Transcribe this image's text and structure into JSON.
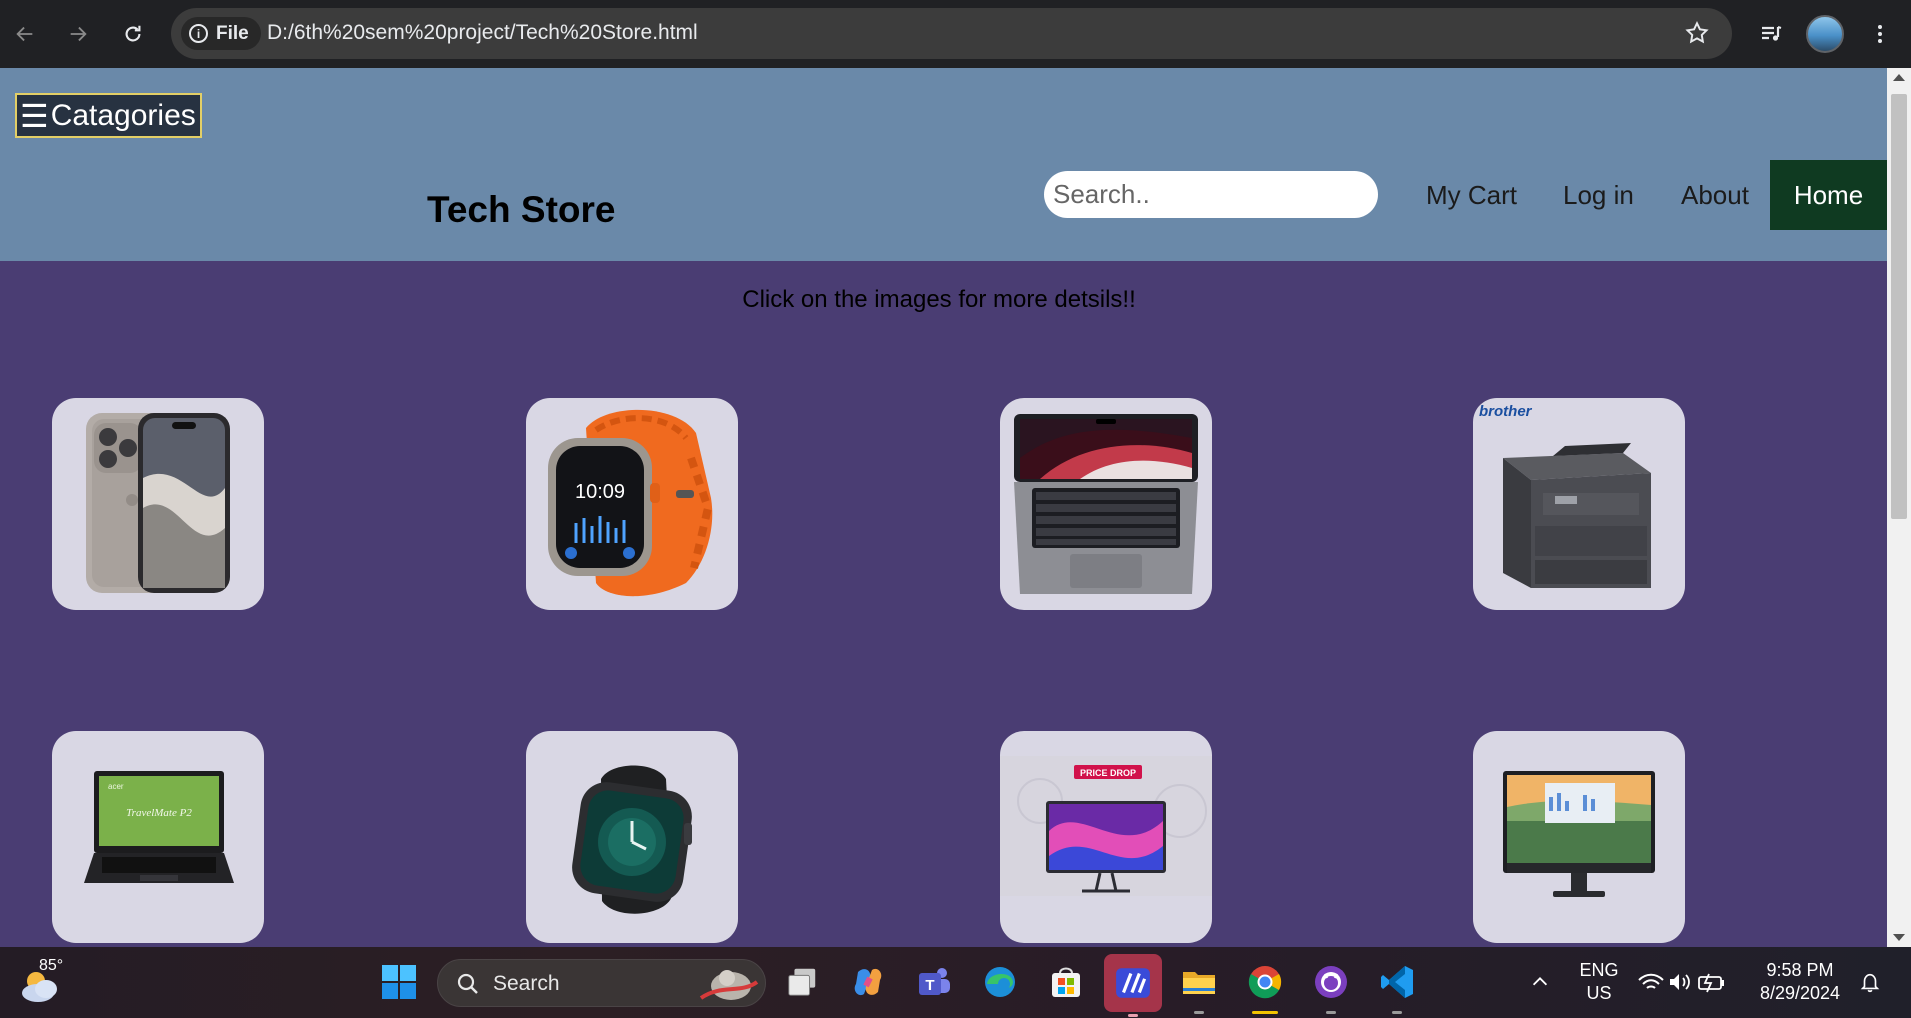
{
  "browser": {
    "address_chip": "File",
    "url": "D:/6th%20sem%20project/Tech%20Store.html"
  },
  "header": {
    "categories_label": "Catagories",
    "store_title": "Tech Store",
    "search_placeholder": "Search..",
    "nav": {
      "cart": "My Cart",
      "login": "Log in",
      "about": "About",
      "home": "Home"
    }
  },
  "main": {
    "hint": "Click on the images for more detsils!!",
    "products": [
      {
        "name": "iphone"
      },
      {
        "name": "smartwatch-orange-band"
      },
      {
        "name": "macbook"
      },
      {
        "name": "brother-printer",
        "brand_text": "brother"
      },
      {
        "name": "acer-laptop",
        "screen_text": "TravelMate P2",
        "brand_text": "acer"
      },
      {
        "name": "smartwatch-black"
      },
      {
        "name": "monitor-price-drop",
        "badge_text": "PRICE DROP"
      },
      {
        "name": "dell-monitor"
      }
    ]
  },
  "taskbar": {
    "weather_temp": "85°",
    "search_label": "Search",
    "language_line1": "ENG",
    "language_line2": "US",
    "time": "9:58 PM",
    "date": "8/29/2024"
  },
  "colors": {
    "header_bg": "#6a89a9",
    "page_bg": "#4a3d73",
    "home_bg": "#0f3a21",
    "card_bg": "#d9d7e4"
  }
}
